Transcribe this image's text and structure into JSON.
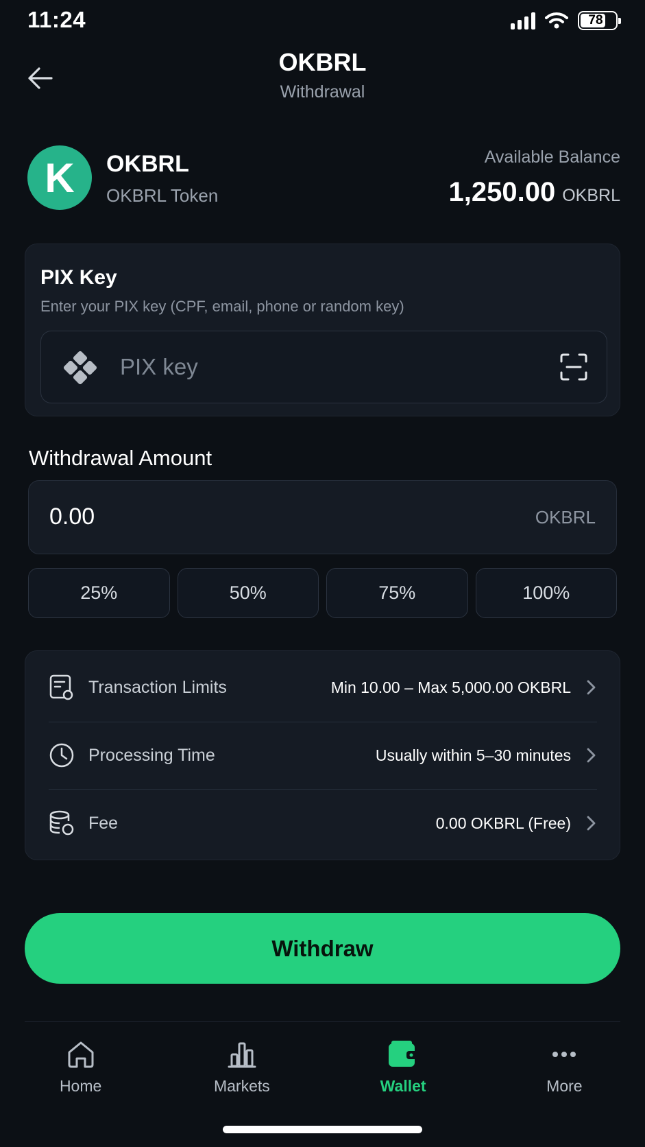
{
  "status_bar": {
    "time": "11:24",
    "battery_percent": "78",
    "signal_bars": 4
  },
  "header": {
    "title": "OKBRL",
    "subtitle": "Withdrawal",
    "back_icon": "arrow-left-icon"
  },
  "token": {
    "logo_letter": "K",
    "logo_color": "#26b38a",
    "name": "OKBRL",
    "full_name": "OKBRL Token",
    "balance_label": "Available Balance",
    "balance_value": "1,250.00",
    "balance_unit": "OKBRL"
  },
  "pix": {
    "title": "PIX Key",
    "description": "Enter your PIX key (CPF, email, phone or random key)",
    "placeholder": "PIX key",
    "icon": "pix-icon",
    "scan_icon": "scan-icon"
  },
  "amount": {
    "label": "Withdrawal Amount",
    "value": "0.00",
    "unit": "OKBRL",
    "percent_buttons": [
      "25%",
      "50%",
      "75%",
      "100%"
    ]
  },
  "info": {
    "rows": [
      {
        "icon": "receipt-icon",
        "label": "Transaction Limits",
        "value": "Min 10.00 – Max 5,000.00 OKBRL"
      },
      {
        "icon": "clock-icon",
        "label": "Processing Time",
        "value": "Usually within 5–30 minutes"
      },
      {
        "icon": "coins-icon",
        "label": "Fee",
        "value": "0.00 OKBRL (Free)"
      }
    ]
  },
  "actions": {
    "withdraw_label": "Withdraw",
    "accent_color": "#25d07f"
  },
  "nav": {
    "items": [
      {
        "label": "Home",
        "icon": "home-icon",
        "active": false
      },
      {
        "label": "Markets",
        "icon": "bar-chart-icon",
        "active": false
      },
      {
        "label": "Wallet",
        "icon": "wallet-icon",
        "active": true
      },
      {
        "label": "More",
        "icon": "more-dots-icon",
        "active": false
      }
    ]
  }
}
